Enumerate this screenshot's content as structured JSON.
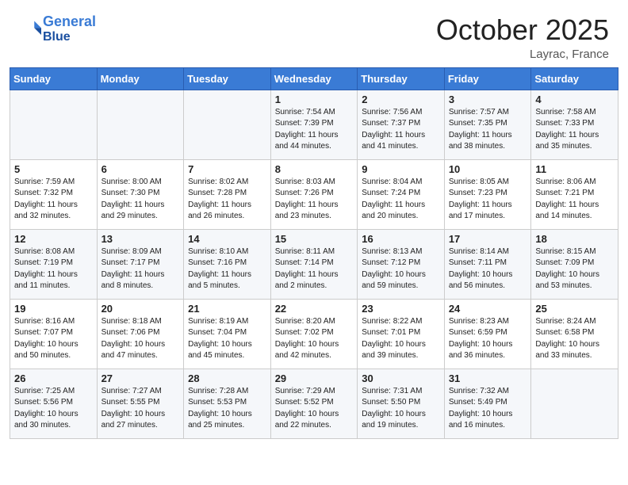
{
  "header": {
    "logo_line1": "General",
    "logo_line2": "Blue",
    "month": "October 2025",
    "location": "Layrac, France"
  },
  "weekdays": [
    "Sunday",
    "Monday",
    "Tuesday",
    "Wednesday",
    "Thursday",
    "Friday",
    "Saturday"
  ],
  "weeks": [
    [
      {
        "day": "",
        "info": ""
      },
      {
        "day": "",
        "info": ""
      },
      {
        "day": "",
        "info": ""
      },
      {
        "day": "1",
        "info": "Sunrise: 7:54 AM\nSunset: 7:39 PM\nDaylight: 11 hours\nand 44 minutes."
      },
      {
        "day": "2",
        "info": "Sunrise: 7:56 AM\nSunset: 7:37 PM\nDaylight: 11 hours\nand 41 minutes."
      },
      {
        "day": "3",
        "info": "Sunrise: 7:57 AM\nSunset: 7:35 PM\nDaylight: 11 hours\nand 38 minutes."
      },
      {
        "day": "4",
        "info": "Sunrise: 7:58 AM\nSunset: 7:33 PM\nDaylight: 11 hours\nand 35 minutes."
      }
    ],
    [
      {
        "day": "5",
        "info": "Sunrise: 7:59 AM\nSunset: 7:32 PM\nDaylight: 11 hours\nand 32 minutes."
      },
      {
        "day": "6",
        "info": "Sunrise: 8:00 AM\nSunset: 7:30 PM\nDaylight: 11 hours\nand 29 minutes."
      },
      {
        "day": "7",
        "info": "Sunrise: 8:02 AM\nSunset: 7:28 PM\nDaylight: 11 hours\nand 26 minutes."
      },
      {
        "day": "8",
        "info": "Sunrise: 8:03 AM\nSunset: 7:26 PM\nDaylight: 11 hours\nand 23 minutes."
      },
      {
        "day": "9",
        "info": "Sunrise: 8:04 AM\nSunset: 7:24 PM\nDaylight: 11 hours\nand 20 minutes."
      },
      {
        "day": "10",
        "info": "Sunrise: 8:05 AM\nSunset: 7:23 PM\nDaylight: 11 hours\nand 17 minutes."
      },
      {
        "day": "11",
        "info": "Sunrise: 8:06 AM\nSunset: 7:21 PM\nDaylight: 11 hours\nand 14 minutes."
      }
    ],
    [
      {
        "day": "12",
        "info": "Sunrise: 8:08 AM\nSunset: 7:19 PM\nDaylight: 11 hours\nand 11 minutes."
      },
      {
        "day": "13",
        "info": "Sunrise: 8:09 AM\nSunset: 7:17 PM\nDaylight: 11 hours\nand 8 minutes."
      },
      {
        "day": "14",
        "info": "Sunrise: 8:10 AM\nSunset: 7:16 PM\nDaylight: 11 hours\nand 5 minutes."
      },
      {
        "day": "15",
        "info": "Sunrise: 8:11 AM\nSunset: 7:14 PM\nDaylight: 11 hours\nand 2 minutes."
      },
      {
        "day": "16",
        "info": "Sunrise: 8:13 AM\nSunset: 7:12 PM\nDaylight: 10 hours\nand 59 minutes."
      },
      {
        "day": "17",
        "info": "Sunrise: 8:14 AM\nSunset: 7:11 PM\nDaylight: 10 hours\nand 56 minutes."
      },
      {
        "day": "18",
        "info": "Sunrise: 8:15 AM\nSunset: 7:09 PM\nDaylight: 10 hours\nand 53 minutes."
      }
    ],
    [
      {
        "day": "19",
        "info": "Sunrise: 8:16 AM\nSunset: 7:07 PM\nDaylight: 10 hours\nand 50 minutes."
      },
      {
        "day": "20",
        "info": "Sunrise: 8:18 AM\nSunset: 7:06 PM\nDaylight: 10 hours\nand 47 minutes."
      },
      {
        "day": "21",
        "info": "Sunrise: 8:19 AM\nSunset: 7:04 PM\nDaylight: 10 hours\nand 45 minutes."
      },
      {
        "day": "22",
        "info": "Sunrise: 8:20 AM\nSunset: 7:02 PM\nDaylight: 10 hours\nand 42 minutes."
      },
      {
        "day": "23",
        "info": "Sunrise: 8:22 AM\nSunset: 7:01 PM\nDaylight: 10 hours\nand 39 minutes."
      },
      {
        "day": "24",
        "info": "Sunrise: 8:23 AM\nSunset: 6:59 PM\nDaylight: 10 hours\nand 36 minutes."
      },
      {
        "day": "25",
        "info": "Sunrise: 8:24 AM\nSunset: 6:58 PM\nDaylight: 10 hours\nand 33 minutes."
      }
    ],
    [
      {
        "day": "26",
        "info": "Sunrise: 7:25 AM\nSunset: 5:56 PM\nDaylight: 10 hours\nand 30 minutes."
      },
      {
        "day": "27",
        "info": "Sunrise: 7:27 AM\nSunset: 5:55 PM\nDaylight: 10 hours\nand 27 minutes."
      },
      {
        "day": "28",
        "info": "Sunrise: 7:28 AM\nSunset: 5:53 PM\nDaylight: 10 hours\nand 25 minutes."
      },
      {
        "day": "29",
        "info": "Sunrise: 7:29 AM\nSunset: 5:52 PM\nDaylight: 10 hours\nand 22 minutes."
      },
      {
        "day": "30",
        "info": "Sunrise: 7:31 AM\nSunset: 5:50 PM\nDaylight: 10 hours\nand 19 minutes."
      },
      {
        "day": "31",
        "info": "Sunrise: 7:32 AM\nSunset: 5:49 PM\nDaylight: 10 hours\nand 16 minutes."
      },
      {
        "day": "",
        "info": ""
      }
    ]
  ]
}
